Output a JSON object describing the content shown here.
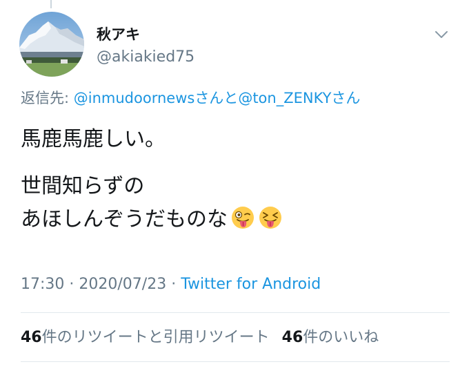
{
  "tweet": {
    "author": {
      "display_name": "秋アキ",
      "handle": "@akiakied75",
      "avatar_icon": "mountain-landscape-avatar"
    },
    "reply": {
      "prefix": "返信先: ",
      "mention_1": "@inmudoornews",
      "joiner": "さんと",
      "mention_2": "@ton_ZENKY",
      "suffix": "さん"
    },
    "text": {
      "line_1": "馬鹿馬鹿しい。",
      "line_2": "世間知らずの",
      "line_3": "あほしんぞうだものな",
      "emoji_1": "winking-face-with-tongue-icon",
      "emoji_2": "squinting-face-with-tongue-icon"
    },
    "meta": {
      "time": "17:30",
      "separator_1": " · ",
      "date": "2020/07/23",
      "separator_2": " · ",
      "source": "Twitter for Android"
    },
    "stats": {
      "retweets_count": "46",
      "retweets_label": "件のリツイートと引用リツイート",
      "likes_count": "46",
      "likes_label": "件のいいね"
    }
  },
  "colors": {
    "link": "#1b95e0",
    "secondary_text": "#657786",
    "primary_text": "#14171a",
    "divider": "#e1e8ed"
  }
}
